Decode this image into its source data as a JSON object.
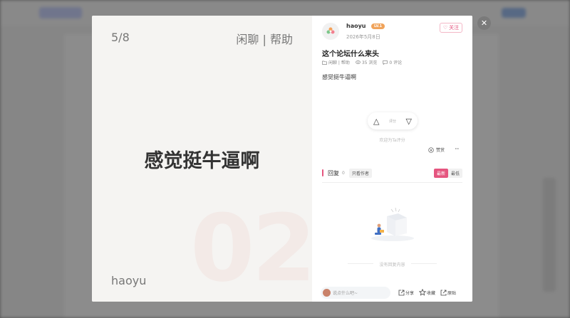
{
  "viewer": {
    "counter": "5/8",
    "category": "闲聊 | 帮助",
    "main_text": "感觉挺牛逼啊",
    "author": "haoyu",
    "bg_number": "02"
  },
  "post": {
    "username": "haoyu",
    "level": "LV.1",
    "date": "2026年5月8日",
    "follow_label": "关注",
    "title": "这个论坛什么来头",
    "category": "闲聊 | 帮助",
    "views": "35 浏览",
    "comments": "0 评论",
    "content": "感觉挺牛逼啊",
    "rate_label": "评分",
    "rate_hint": "欢迎为Ta评分",
    "tip_label": "赞赏",
    "more_label": "···"
  },
  "replies": {
    "label": "回复",
    "count": "0",
    "only_author": "只看作者",
    "sort_latest": "最新",
    "sort_oldest": "最低",
    "empty_text": "没有回复内容"
  },
  "footer": {
    "placeholder": "说点什么吧~",
    "share": "分享",
    "favorite": "收藏",
    "repost": "原贴"
  },
  "colors": {
    "accent": "#e5557f",
    "level_badge": "#f0a35a"
  }
}
